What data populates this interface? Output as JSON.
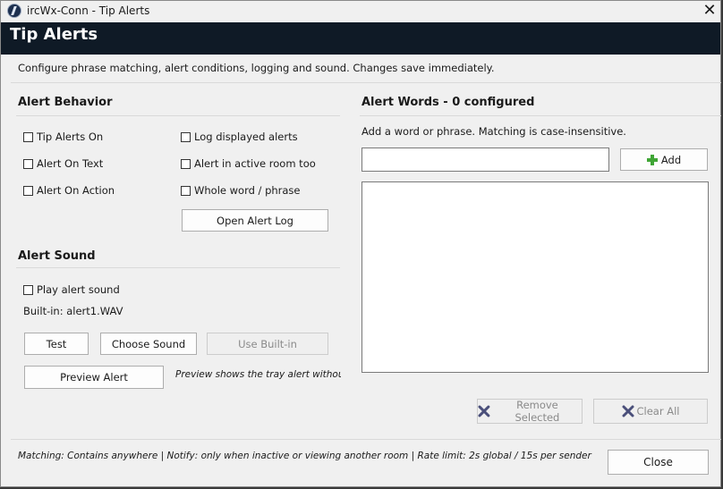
{
  "window": {
    "title": "ircWx-Conn - Tip Alerts",
    "close_glyph": "✕"
  },
  "header": {
    "title": "Tip Alerts"
  },
  "description": "Configure phrase matching, alert conditions, logging and sound. Changes save immediately.",
  "alert_behavior": {
    "title": "Alert Behavior",
    "left_options": [
      {
        "label": "Tip Alerts On",
        "checked": false
      },
      {
        "label": "Alert On Text",
        "checked": false
      },
      {
        "label": "Alert On Action",
        "checked": false
      }
    ],
    "right_options": [
      {
        "label": "Log displayed alerts",
        "checked": false
      },
      {
        "label": "Alert in active room too",
        "checked": false
      },
      {
        "label": "Whole word / phrase",
        "checked": false
      }
    ],
    "open_log_label": "Open Alert Log"
  },
  "alert_sound": {
    "title": "Alert Sound",
    "play_label": "Play alert sound",
    "builtin_text": "Built-in: alert1.WAV",
    "test_label": "Test",
    "choose_label": "Choose Sound",
    "use_builtin_label": "Use Built-in",
    "preview_label": "Preview Alert",
    "preview_note": "Preview shows the tray alert without"
  },
  "alert_words": {
    "title": "Alert Words - 0 configured",
    "hint": "Add a word or phrase. Matching is case-insensitive.",
    "input_value": "",
    "add_label": "Add",
    "remove_label": "Remove Selected",
    "clear_label": "Clear All"
  },
  "footer": {
    "summary": "Matching: Contains anywhere | Notify: only when inactive or viewing another room | Rate limit: 2s global / 15s per sender",
    "close_label": "Close"
  },
  "colors": {
    "header_bg": "#0f1a26",
    "add_icon": "#3fa535",
    "x_icon": "#4a4f7a"
  }
}
